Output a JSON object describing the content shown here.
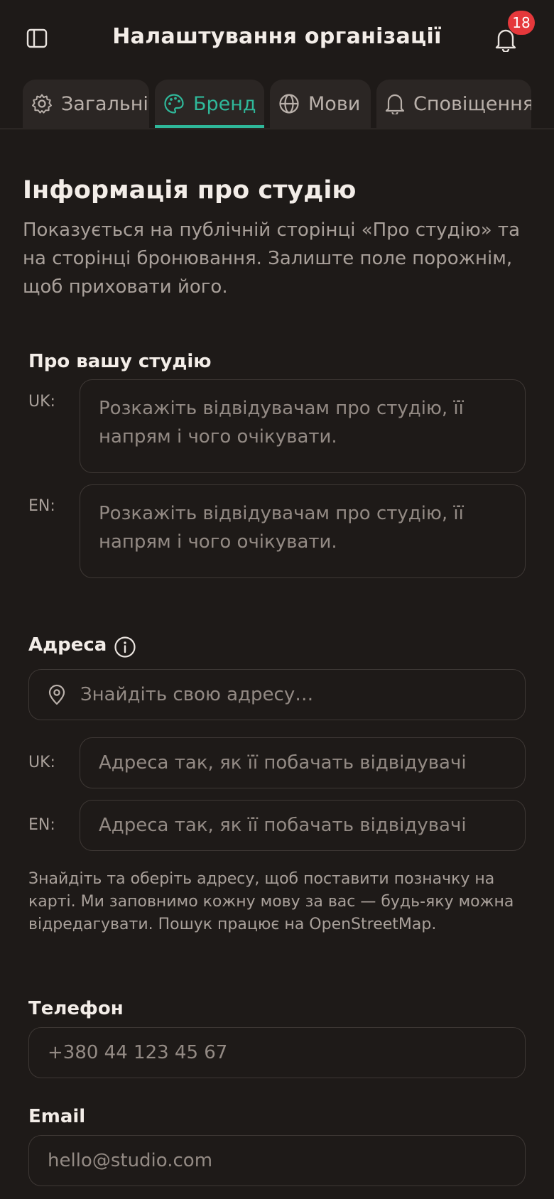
{
  "header": {
    "title": "Налаштування організації",
    "notification_count": "18"
  },
  "tabs": [
    {
      "label": "Загальні",
      "icon": "gear-icon",
      "active": false
    },
    {
      "label": "Бренд",
      "icon": "palette-icon",
      "active": true
    },
    {
      "label": "Мови",
      "icon": "globe-icon",
      "active": false
    },
    {
      "label": "Сповіщення",
      "icon": "bell-icon",
      "active": false
    }
  ],
  "section": {
    "title": "Інформація про студію",
    "description": "Показується на публічній сторінці «Про студію» та на сторінці бронювання. Залиште поле порожнім, щоб приховати його."
  },
  "about": {
    "label": "Про вашу студію",
    "uk_tag": "UK:",
    "en_tag": "EN:",
    "uk_placeholder": "Розкажіть відвідувачам про студію, її напрям і чого очікувати.",
    "en_placeholder": "Розкажіть відвідувачам про студію, її напрям і чого очікувати."
  },
  "address": {
    "label": "Адреса",
    "search_placeholder": "Знайдіть свою адресу…",
    "uk_tag": "UK:",
    "en_tag": "EN:",
    "uk_placeholder": "Адреса так, як її побачать відвідувачі",
    "en_placeholder": "Адреса так, як її побачать відвідувачі",
    "help": "Знайдіть та оберіть адресу, щоб поставити позначку на карті. Ми заповнимо кожну мову за вас — будь-яку можна відредагувати. Пошук працює на OpenStreetMap."
  },
  "phone": {
    "label": "Телефон",
    "placeholder": "+380 44 123 45 67"
  },
  "email": {
    "label": "Email",
    "placeholder": "hello@studio.com"
  },
  "colors": {
    "background": "#1e1a18",
    "accent": "#2fb89a",
    "badge": "#e5383b"
  }
}
